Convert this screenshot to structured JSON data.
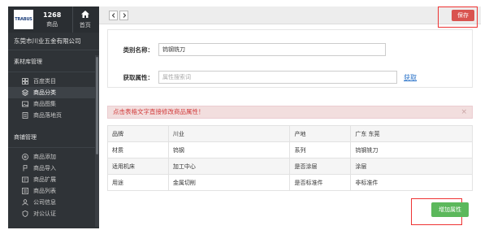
{
  "sidebar": {
    "logo_text": "TRABUS",
    "count": "1268",
    "count_label": "商品",
    "home_label": "首页",
    "company": "东莞市川业五金有限公司",
    "section1": "素材库管理",
    "section1_items": [
      {
        "label": "百度类目",
        "icon": "grid-icon"
      },
      {
        "label": "商品分类",
        "icon": "layers-icon"
      },
      {
        "label": "商品图集",
        "icon": "image-icon"
      },
      {
        "label": "商品落地页",
        "icon": "page-icon"
      }
    ],
    "section2": "商铺管理",
    "section2_items": [
      {
        "label": "商品添加",
        "icon": "plus-circle-icon"
      },
      {
        "label": "商品导入",
        "icon": "import-icon"
      },
      {
        "label": "商品扩展",
        "icon": "expand-icon"
      },
      {
        "label": "商品列表",
        "icon": "list-icon"
      },
      {
        "label": "公司信息",
        "icon": "user-icon"
      },
      {
        "label": "对公认证",
        "icon": "shield-icon"
      }
    ]
  },
  "toolbar": {
    "save_label": "保存"
  },
  "form": {
    "category_label": "类别名称：",
    "category_value": "钨钢铣刀",
    "attr_label": "获取属性：",
    "attr_placeholder": "属性搜索词",
    "attr_link": "获取"
  },
  "alert": {
    "text": "点击表格文字直接修改商品属性！",
    "close": "×"
  },
  "table": {
    "rows": [
      [
        "品牌",
        "川业",
        "产地",
        "广东 东莞"
      ],
      [
        "材质",
        "钨钢",
        "系列",
        "钨钢铣刀"
      ],
      [
        "适用机床",
        "加工中心",
        "是否涂层",
        "涂层"
      ],
      [
        "用途",
        "金属切削",
        "是否标准件",
        "非标准件"
      ]
    ]
  },
  "add_button": "增加属性",
  "colors": {
    "sidebar_bg": "#2f3337",
    "save_red": "#d9534f",
    "add_green": "#5cb85c",
    "alert_text": "#d23b3b",
    "link_blue": "#2b73c9"
  }
}
